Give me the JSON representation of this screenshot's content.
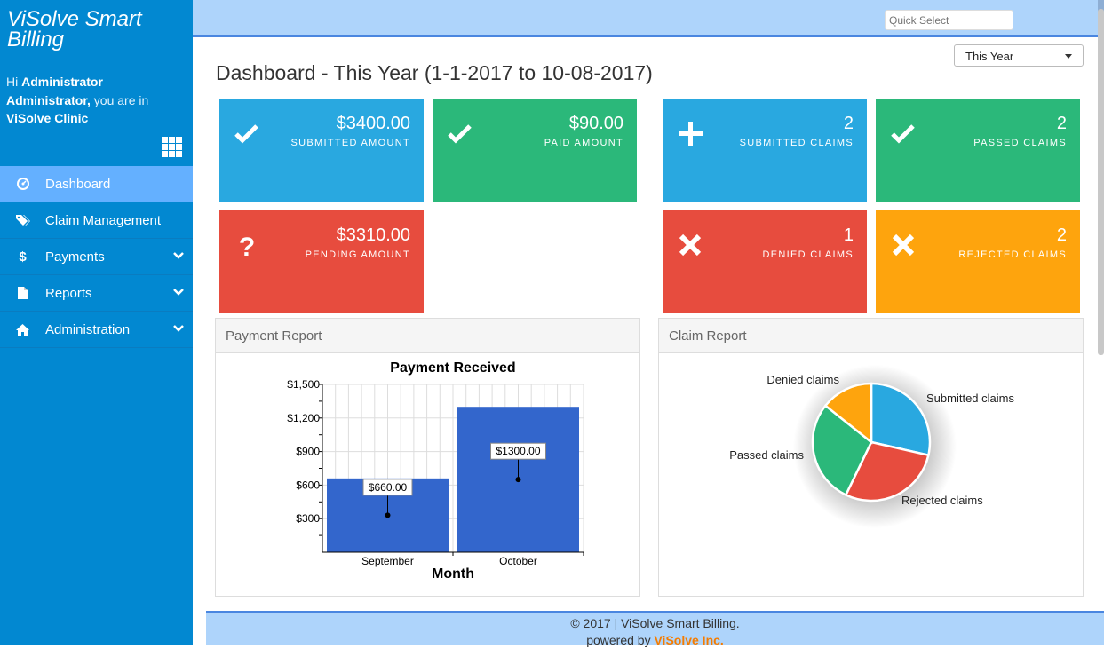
{
  "sidebar": {
    "brand": "ViSolve Smart Billing",
    "greeting": {
      "hi": "Hi",
      "user": "Administrator Administrator,",
      "mid": "you are in",
      "clinic": "ViSolve Clinic"
    },
    "apps_icon": "grid-icon",
    "items": [
      {
        "label": "Dashboard",
        "icon": "dashboard-icon",
        "active": true,
        "expandable": false
      },
      {
        "label": "Claim Management",
        "icon": "tags-icon",
        "active": false,
        "expandable": false
      },
      {
        "label": "Payments",
        "icon": "dollar-icon",
        "active": false,
        "expandable": true
      },
      {
        "label": "Reports",
        "icon": "file-icon",
        "active": false,
        "expandable": true
      },
      {
        "label": "Administration",
        "icon": "home-icon",
        "active": false,
        "expandable": true
      }
    ]
  },
  "topbar": {
    "quick_select_placeholder": "Quick Select"
  },
  "page": {
    "title": "Dashboard - This Year (1-1-2017 to 10-08-2017)",
    "period_select": "This Year"
  },
  "tiles": [
    {
      "value": "$3400.00",
      "label": "SUBMITTED AMOUNT",
      "icon": "check-icon",
      "color": "#29a8e0"
    },
    {
      "value": "$90.00",
      "label": "PAID AMOUNT",
      "icon": "check-icon",
      "color": "#2bb87a"
    },
    {
      "value": "$3310.00",
      "label": "PENDING AMOUNT",
      "icon": "question-icon",
      "color": "#e74c3e"
    },
    {
      "value": "2",
      "label": "SUBMITTED CLAIMS",
      "icon": "plus-icon",
      "color": "#29a8e0"
    },
    {
      "value": "2",
      "label": "PASSED CLAIMS",
      "icon": "check-icon",
      "color": "#2bb87a"
    },
    {
      "value": "1",
      "label": "DENIED CLAIMS",
      "icon": "times-icon",
      "color": "#e74c3e"
    },
    {
      "value": "2",
      "label": "REJECTED CLAIMS",
      "icon": "times-icon",
      "color": "#fea40d"
    }
  ],
  "panels": {
    "payment": "Payment Report",
    "claim": "Claim Report"
  },
  "chart_data": [
    {
      "type": "bar",
      "title": "Payment Received",
      "xlabel": "Month",
      "ylabel": "",
      "categories": [
        "September",
        "October"
      ],
      "values": [
        660,
        1300
      ],
      "data_labels": [
        "$660.00",
        "$1300.00"
      ],
      "yticks": [
        "$300",
        "$600",
        "$900",
        "$1,200",
        "$1,500"
      ],
      "ylim": [
        0,
        1500
      ],
      "grid": true,
      "color": "#3366cc"
    },
    {
      "type": "pie",
      "title": "",
      "slices": [
        {
          "label": "Submitted claims",
          "value": 2,
          "color": "#29a8e0"
        },
        {
          "label": "Rejected claims",
          "value": 2,
          "color": "#e74c3e"
        },
        {
          "label": "Passed claims",
          "value": 2,
          "color": "#2bb87a"
        },
        {
          "label": "Denied claims",
          "value": 1,
          "color": "#fea40d"
        }
      ]
    }
  ],
  "footer": {
    "copyright": "© 2017 | ViSolve Smart Billing.",
    "powered": "powered by",
    "org": "ViSolve Inc."
  }
}
